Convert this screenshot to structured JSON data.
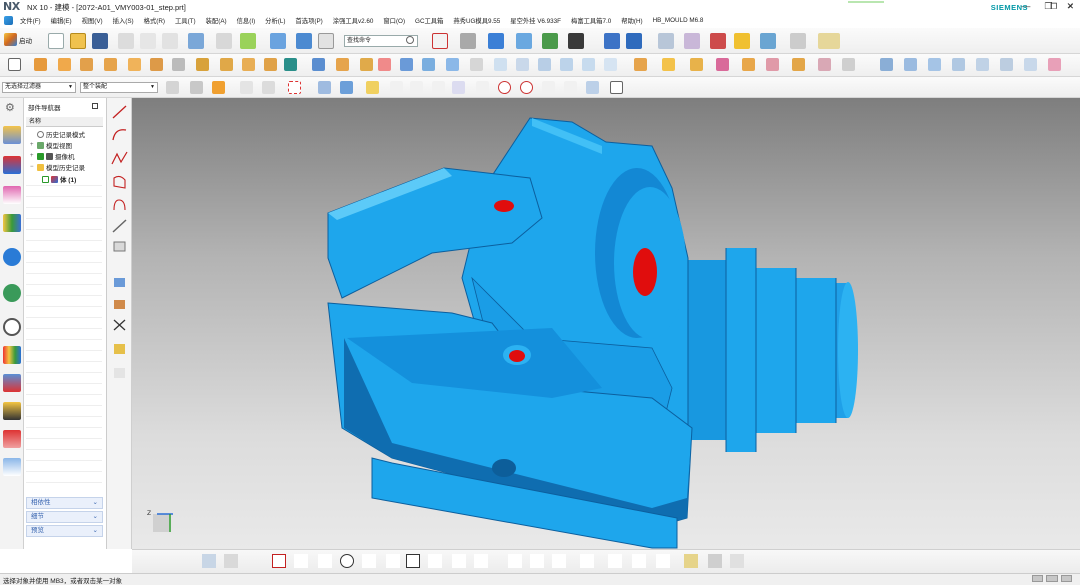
{
  "app": {
    "brand_short": "NX",
    "window_title": "NX 10 - 建模 - [2072-A01_VMY003-01_step.prt]",
    "vendor": "SIEMENS"
  },
  "menubar": {
    "items": [
      "文件(F)",
      "编辑(E)",
      "视图(V)",
      "插入(S)",
      "格式(R)",
      "工具(T)",
      "装配(A)",
      "信息(I)",
      "分析(L)",
      "首选项(P)",
      "涂强工具v2.60",
      "窗口(O)",
      "GC工具箱",
      "燕秀UG模具9.55",
      "星空外挂 V6.933F",
      "梅富工具箱7.0",
      "帮助(H)",
      "HB_MOULD M6.8"
    ]
  },
  "toolbar": {
    "start_label": "启动",
    "search_placeholder": "查找命令",
    "selection_filter": "无选择过滤器",
    "assembly_filter": "整个装配"
  },
  "navigator": {
    "title": "部件导航器",
    "column_header": "名称",
    "tree": [
      {
        "label": "历史记录模式",
        "indent": 0
      },
      {
        "label": "模型视图",
        "indent": 0
      },
      {
        "label": "摄像机",
        "indent": 0
      },
      {
        "label": "模型历史记录",
        "indent": 0
      },
      {
        "label": "体 (1)",
        "indent": 1
      }
    ],
    "panels": [
      "相依性",
      "细节",
      "预览"
    ]
  },
  "status": {
    "text": "选择对象并使用 MB3，或者双击某一对象"
  },
  "colors": {
    "model_blue": "#1ea6ec",
    "model_shadow": "#0c5f9e",
    "hole_red": "#e00d0d",
    "viewport_top": "#7e7e7e",
    "viewport_bottom": "#e9e9e9",
    "brand_teal": "#0098a6"
  }
}
